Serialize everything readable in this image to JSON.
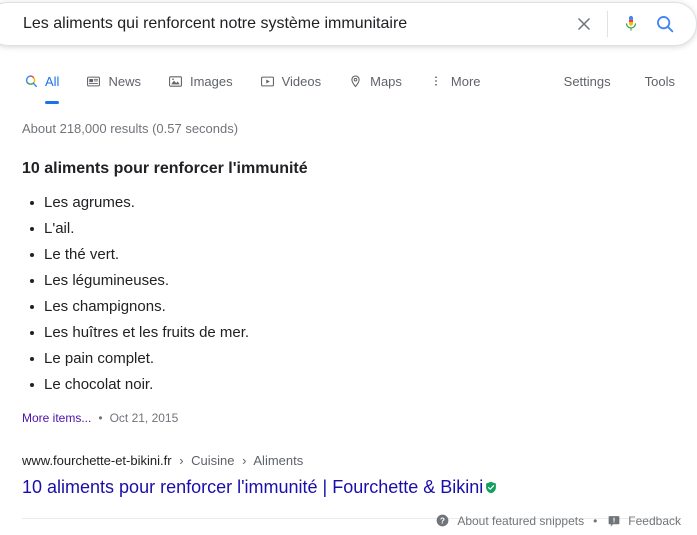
{
  "search": {
    "query": "Les aliments qui renforcent notre système immunitaire",
    "placeholder": "Search",
    "clear_icon": "close-icon",
    "mic_icon": "microphone-icon",
    "search_icon": "search-icon"
  },
  "nav": {
    "tabs": [
      {
        "label": "All",
        "icon": "google-search-icon",
        "active": true
      },
      {
        "label": "News",
        "icon": "news-icon",
        "active": false
      },
      {
        "label": "Images",
        "icon": "image-icon",
        "active": false
      },
      {
        "label": "Videos",
        "icon": "video-icon",
        "active": false
      },
      {
        "label": "Maps",
        "icon": "map-pin-icon",
        "active": false
      },
      {
        "label": "More",
        "icon": "more-vertical-icon",
        "active": false
      }
    ],
    "settings_label": "Settings",
    "tools_label": "Tools"
  },
  "results": {
    "count_text": "About 218,000 results (0.57 seconds)"
  },
  "featured_snippet": {
    "heading": "10 aliments pour renforcer l'immunité",
    "items": [
      "Les agrumes.",
      "L'ail.",
      "Le thé vert.",
      "Les légumineuses.",
      "Les champignons.",
      "Les huîtres et les fruits de mer.",
      "Le pain complet.",
      "Le chocolat noir."
    ],
    "more_items_label": "More items...",
    "separator": "•",
    "date": "Oct 21, 2015",
    "source": {
      "domain": "www.fourchette-et-bikini.fr",
      "crumb_separator": "›",
      "breadcrumbs": [
        "Cuisine",
        "Aliments"
      ],
      "title": "10 aliments pour renforcer l'immunité | Fourchette & Bikini",
      "badge_icon": "verified-shield-icon"
    }
  },
  "footer": {
    "about_icon": "help-circle-icon",
    "about_label": "About featured snippets",
    "separator": "•",
    "feedback_icon": "feedback-icon",
    "feedback_label": "Feedback"
  },
  "colors": {
    "google_blue": "#4285f4",
    "google_red": "#ea4335",
    "google_yellow": "#fbbc05",
    "google_green": "#34a853",
    "link_blue": "#1a0dab",
    "visited_purple": "#4b11a8",
    "accent_blue": "#1a73e8",
    "badge_green": "#12a05c"
  }
}
